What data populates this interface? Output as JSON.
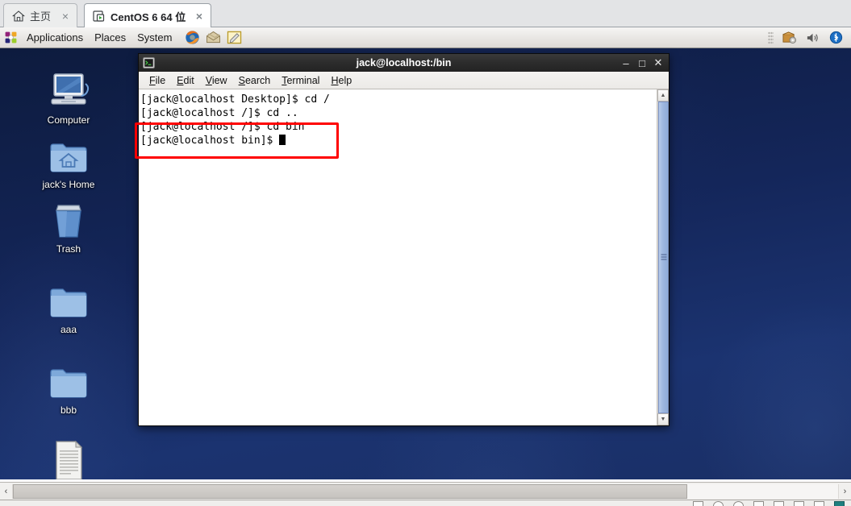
{
  "app": {
    "tabs": [
      {
        "label": "主页",
        "icon": "home-icon",
        "close": "×",
        "active": false
      },
      {
        "label": "CentOS 6 64 位",
        "icon": "vm-icon",
        "close": "×",
        "active": true
      }
    ]
  },
  "gnome_panel": {
    "menus": [
      "Applications",
      "Places",
      "System"
    ],
    "launchers": [
      "firefox-icon",
      "evolution-mail-icon",
      "text-editor-icon"
    ],
    "tray": [
      "package-updater-icon",
      "volume-icon",
      "bluetooth-icon"
    ]
  },
  "desktop": {
    "icons": [
      {
        "label": "Computer",
        "icon": "computer-icon"
      },
      {
        "label": "jack's Home",
        "icon": "home-folder-icon"
      },
      {
        "label": "Trash",
        "icon": "trash-icon"
      },
      {
        "label": "aaa",
        "icon": "folder-icon"
      },
      {
        "label": "bbb",
        "icon": "folder-icon"
      },
      {
        "label": "",
        "icon": "text-document-icon"
      }
    ]
  },
  "terminal": {
    "title": "jack@localhost:/bin",
    "icon": "terminal-icon",
    "window_buttons": {
      "minimize": "–",
      "maximize": "□",
      "close": "✕"
    },
    "menus": [
      {
        "mnemonic": "F",
        "rest": "ile"
      },
      {
        "mnemonic": "E",
        "rest": "dit"
      },
      {
        "mnemonic": "V",
        "rest": "iew"
      },
      {
        "mnemonic": "S",
        "rest": "earch"
      },
      {
        "mnemonic": "T",
        "rest": "erminal"
      },
      {
        "mnemonic": "H",
        "rest": "elp"
      }
    ],
    "lines": [
      "[jack@localhost Desktop]$ cd /",
      "[jack@localhost /]$ cd ..",
      "[jack@localhost /]$ cd bin",
      "[jack@localhost bin]$ "
    ],
    "scroll_up": "▲",
    "scroll_down": "▼"
  },
  "annotation": {
    "color": "#ff0000",
    "highlights": [
      "[jack@localhost /]$ cd bin",
      "[jack@localhost bin]$ "
    ]
  },
  "hscrollbar": {
    "left_arrow": "‹",
    "right_arrow": "›"
  },
  "colors": {
    "desktop_bg": "#14265a",
    "titlebar": "#2c2c2c",
    "panel_bg": "#e8e6e3",
    "terminal_bg": "#ffffff",
    "terminal_fg": "#000000",
    "annotation": "#ff0000",
    "tab_active_bg": "#ffffff",
    "scrollbar_thumb": "#9fb8e0"
  }
}
